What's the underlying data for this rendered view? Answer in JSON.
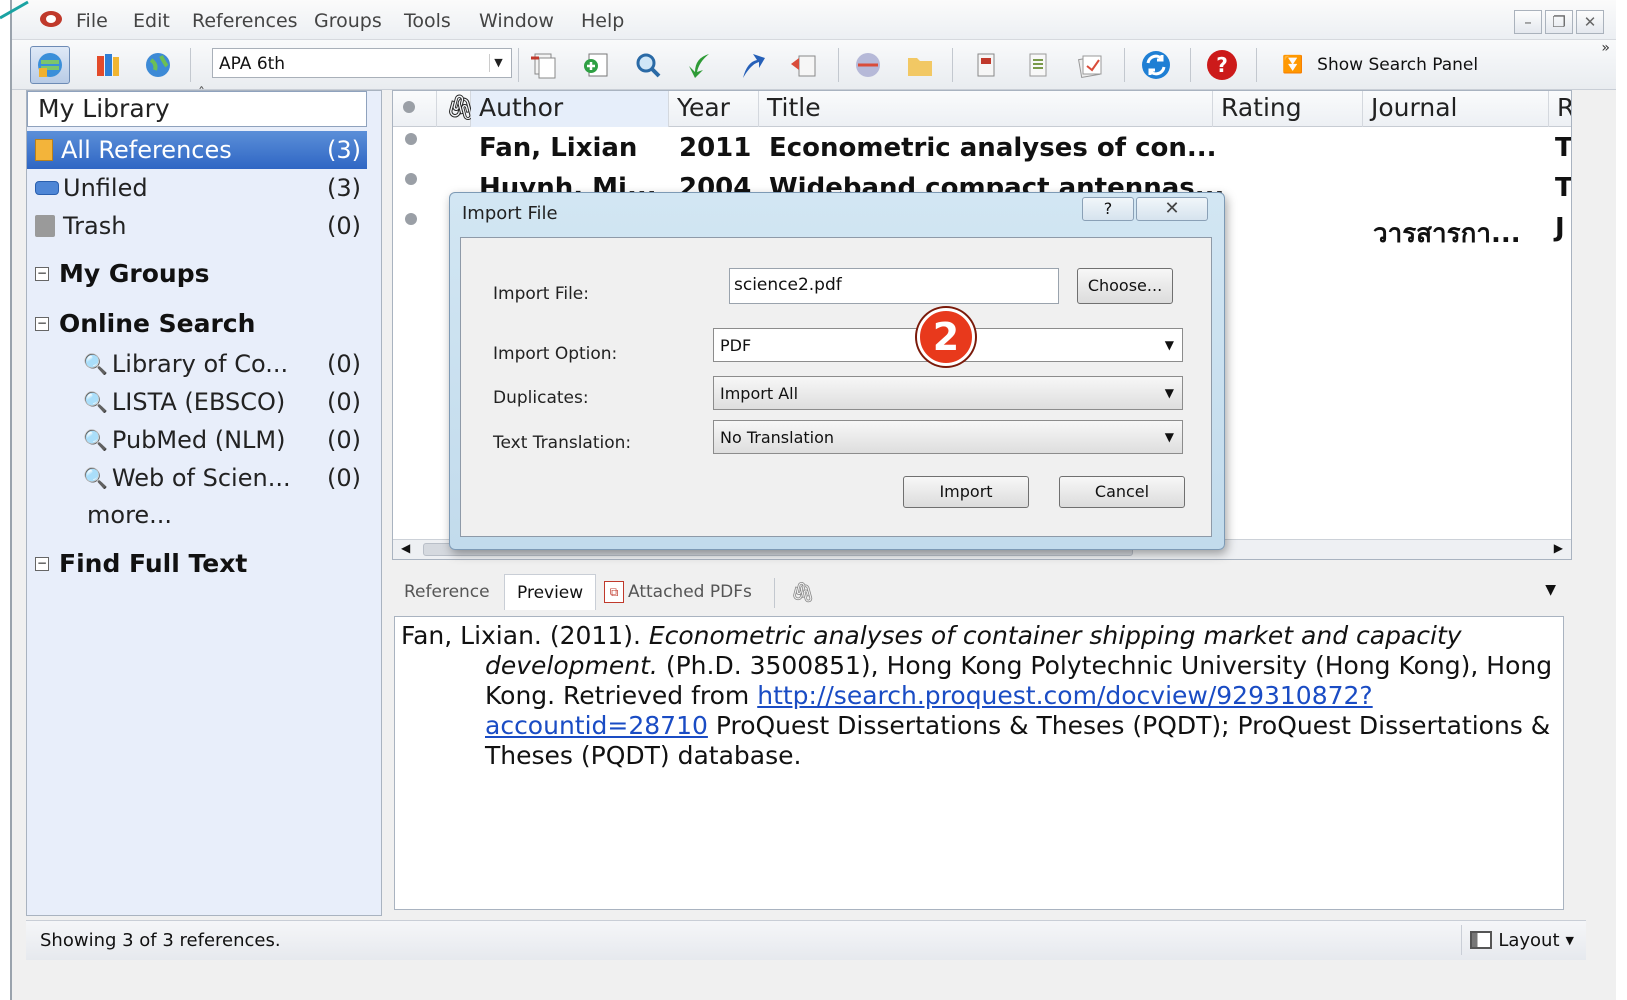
{
  "menu": [
    "File",
    "Edit",
    "References",
    "Groups",
    "Tools",
    "Window",
    "Help"
  ],
  "toolbar": {
    "style_value": "APA 6th",
    "show_search_label": "Show Search Panel"
  },
  "library": {
    "header": "My Library",
    "items": [
      {
        "label": "All References",
        "count": "(3)"
      },
      {
        "label": "Unfiled",
        "count": "(3)"
      },
      {
        "label": "Trash",
        "count": "(0)"
      }
    ],
    "my_groups": "My Groups",
    "online_search": "Online Search",
    "search_items": [
      {
        "label": "Library of Co...",
        "count": "(0)"
      },
      {
        "label": "LISTA (EBSCO)",
        "count": "(0)"
      },
      {
        "label": "PubMed (NLM)",
        "count": "(0)"
      },
      {
        "label": "Web of Scien...",
        "count": "(0)"
      }
    ],
    "more": "more...",
    "find_full_text": "Find Full Text"
  },
  "ref_list": {
    "columns": [
      "Author",
      "Year",
      "Title",
      "Rating",
      "Journal",
      "R"
    ],
    "rows": [
      {
        "author": "Fan, Lixian",
        "year": "2011",
        "title": "Econometric analyses of con...",
        "journal": "",
        "last": "T"
      },
      {
        "author": "Huynh, Mi...",
        "year": "2004",
        "title": "Wideband compact antennas...",
        "journal": "",
        "last": "T"
      },
      {
        "author": "",
        "year": "",
        "title": "",
        "journal": "วารสารกา...",
        "last": "J"
      }
    ]
  },
  "preview": {
    "tabs": [
      "Reference",
      "Preview",
      "Attached PDFs"
    ],
    "line1_plain": "Fan, Lixian. (2011). ",
    "line1_italic": "Econometric analyses of container shipping market and capacity development.",
    "line2_plain": " (Ph.D. 3500851), Hong Kong Polytechnic University (Hong Kong), Hong Kong. Retrieved from ",
    "link": "http://search.proquest.com/docview/929310872?accountid=28710",
    "line3_plain": " ProQuest Dissertations & Theses (PQDT); ProQuest Dissertations & Theses (PQDT) database."
  },
  "status": {
    "text": "Showing 3 of 3 references.",
    "layout_label": "Layout"
  },
  "dialog": {
    "title": "Import File",
    "help": "?",
    "close": "✕",
    "file_label": "Import File:",
    "file_value": "science2.pdf",
    "choose": "Choose...",
    "option_label": "Import Option:",
    "option_value": "PDF",
    "duplicates_label": "Duplicates:",
    "duplicates_value": "Import All",
    "translation_label": "Text Translation:",
    "translation_value": "No Translation",
    "import_btn": "Import",
    "cancel_btn": "Cancel"
  },
  "badge": "2"
}
